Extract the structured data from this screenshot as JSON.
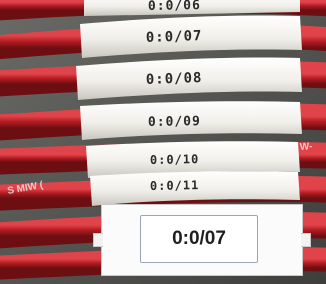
{
  "photo": {
    "subject": "labeled-wire-bundle",
    "sleeve_labels": [
      "0:0/06",
      "0:0/07",
      "0:0/08",
      "0:0/09",
      "0:0/10",
      "0:0/11"
    ],
    "wire_print_left": "S MIW (",
    "wire_print_right": "W-",
    "colors": {
      "wire": "#b51d22",
      "sleeve": "#f3f1ec",
      "background": "#5b5b58"
    }
  },
  "inset": {
    "label_text": "0:0/07"
  }
}
